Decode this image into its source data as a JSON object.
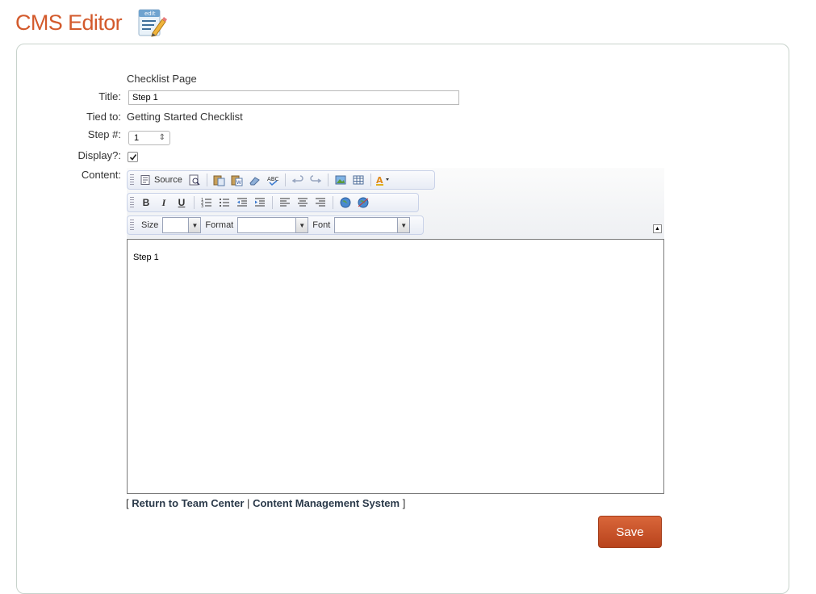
{
  "header": {
    "title": "CMS Editor",
    "icon": "edit-document-icon",
    "accent": "#d35a2c"
  },
  "form": {
    "page_type": "Checklist Page",
    "title_label": "Title:",
    "title_value": "Step 1",
    "tied_label": "Tied to:",
    "tied_value": "Getting Started Checklist",
    "step_label": "Step #:",
    "step_value": "1",
    "display_label": "Display?:",
    "display_checked": true,
    "content_label": "Content:"
  },
  "toolbar": {
    "source_label": "Source",
    "bold": "B",
    "italic": "I",
    "underline": "U",
    "size_label": "Size",
    "format_label": "Format",
    "font_label": "Font"
  },
  "editor": {
    "content": "Step 1"
  },
  "links": {
    "open": "[",
    "return_label": "Return to Team Center",
    "divider": "|",
    "cms_label": "Content Management System",
    "close": "]"
  },
  "actions": {
    "save_label": "Save",
    "save_color": "#c8522a"
  }
}
